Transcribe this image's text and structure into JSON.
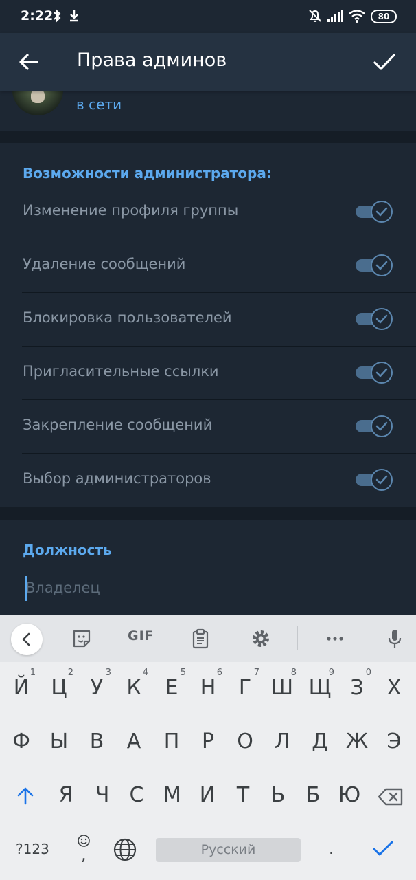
{
  "status_bar": {
    "time": "2:22",
    "battery": "80"
  },
  "app_bar": {
    "title": "Права админов"
  },
  "user": {
    "status": "в сети"
  },
  "permissions": {
    "header": "Возможности администратора:",
    "items": [
      {
        "label": "Изменение профиля группы",
        "enabled": true
      },
      {
        "label": "Удаление сообщений",
        "enabled": true
      },
      {
        "label": "Блокировка пользователей",
        "enabled": true
      },
      {
        "label": "Пригласительные ссылки",
        "enabled": true
      },
      {
        "label": "Закрепление сообщений",
        "enabled": true
      },
      {
        "label": "Выбор администраторов",
        "enabled": true
      }
    ]
  },
  "position": {
    "header": "Должность",
    "placeholder": "Владелец"
  },
  "keyboard": {
    "toolbar": {
      "gif": "GIF"
    },
    "row1": [
      {
        "ch": "Й",
        "hint": "1"
      },
      {
        "ch": "Ц",
        "hint": "2"
      },
      {
        "ch": "У",
        "hint": "3"
      },
      {
        "ch": "К",
        "hint": "4"
      },
      {
        "ch": "Е",
        "hint": "5"
      },
      {
        "ch": "Н",
        "hint": "6"
      },
      {
        "ch": "Г",
        "hint": "7"
      },
      {
        "ch": "Ш",
        "hint": "8"
      },
      {
        "ch": "Щ",
        "hint": "9"
      },
      {
        "ch": "З",
        "hint": "0"
      },
      {
        "ch": "Х",
        "hint": ""
      }
    ],
    "row2": [
      "Ф",
      "Ы",
      "В",
      "А",
      "П",
      "Р",
      "О",
      "Л",
      "Д",
      "Ж",
      "Э"
    ],
    "row3": [
      "Я",
      "Ч",
      "С",
      "М",
      "И",
      "Т",
      "Ь",
      "Б",
      "Ю"
    ],
    "symbols": "?123",
    "comma": ",",
    "space": "Русский",
    "period": ".",
    "accent_color": "#1a73e8"
  }
}
